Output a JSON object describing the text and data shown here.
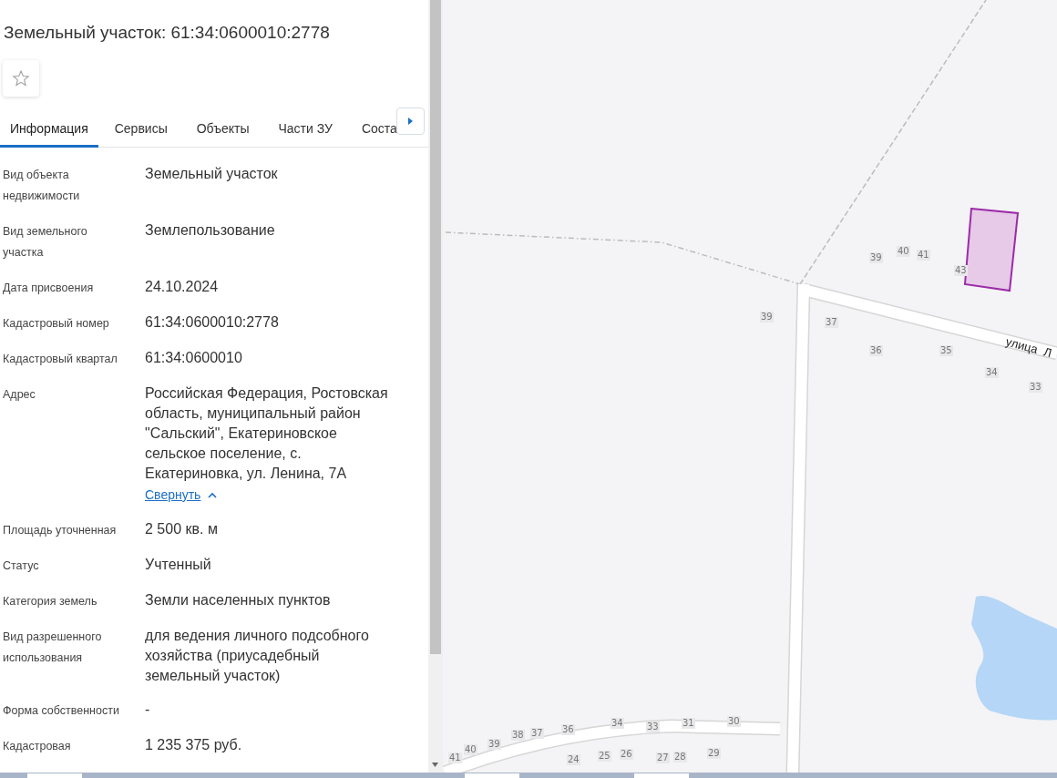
{
  "header": {
    "title": "Земельный участок: 61:34:0600010:2778",
    "favorite": false
  },
  "tabs": [
    {
      "label": "Информация",
      "selected": true
    },
    {
      "label": "Сервисы",
      "selected": false
    },
    {
      "label": "Объекты",
      "selected": false
    },
    {
      "label": "Части ЗУ",
      "selected": false
    },
    {
      "label": "Соста",
      "selected": false
    }
  ],
  "fields": [
    {
      "label": "Вид объекта недвижимости",
      "value": "Земельный участок"
    },
    {
      "label": "Вид земельного участка",
      "value": "Землепользование"
    },
    {
      "label": "Дата присвоения",
      "value": "24.10.2024"
    },
    {
      "label": "Кадастровый номер",
      "value": "61:34:0600010:2778"
    },
    {
      "label": "Кадастровый квартал",
      "value": "61:34:0600010"
    },
    {
      "label": "Адрес",
      "value": "Российская Федерация, Ростовская область, муниципальный район \"Сальский\", Екатериновское сельское поселение, с. Екатериновка, ул. Ленина, 7А",
      "link": "Свернуть"
    },
    {
      "label": "Площадь уточненная",
      "value": "2 500 кв. м"
    },
    {
      "label": "Статус",
      "value": "Учтенный"
    },
    {
      "label": "Категория земель",
      "value": "Земли населенных пунктов"
    },
    {
      "label": "Вид разрешенного использования",
      "value": "для ведения личного подсобного хозяйства (приусадебный земельный участок)"
    },
    {
      "label": "Форма собственности",
      "value": "-"
    },
    {
      "label": "Кадастровая",
      "value": "1 235 375 руб."
    }
  ],
  "map": {
    "labels": [
      {
        "text": "39"
      },
      {
        "text": "40"
      },
      {
        "text": "41"
      },
      {
        "text": "43"
      },
      {
        "text": "39"
      },
      {
        "text": "37"
      },
      {
        "text": "36"
      },
      {
        "text": "35"
      },
      {
        "text": "34"
      },
      {
        "text": "33"
      },
      {
        "text": "41"
      },
      {
        "text": "40"
      },
      {
        "text": "39"
      },
      {
        "text": "38"
      },
      {
        "text": "37"
      },
      {
        "text": "36"
      },
      {
        "text": "34"
      },
      {
        "text": "33"
      },
      {
        "text": "31"
      },
      {
        "text": "30"
      },
      {
        "text": "24"
      },
      {
        "text": "25"
      },
      {
        "text": "26"
      },
      {
        "text": "27"
      },
      {
        "text": "28"
      },
      {
        "text": "29"
      }
    ],
    "street": "улица  Л"
  }
}
